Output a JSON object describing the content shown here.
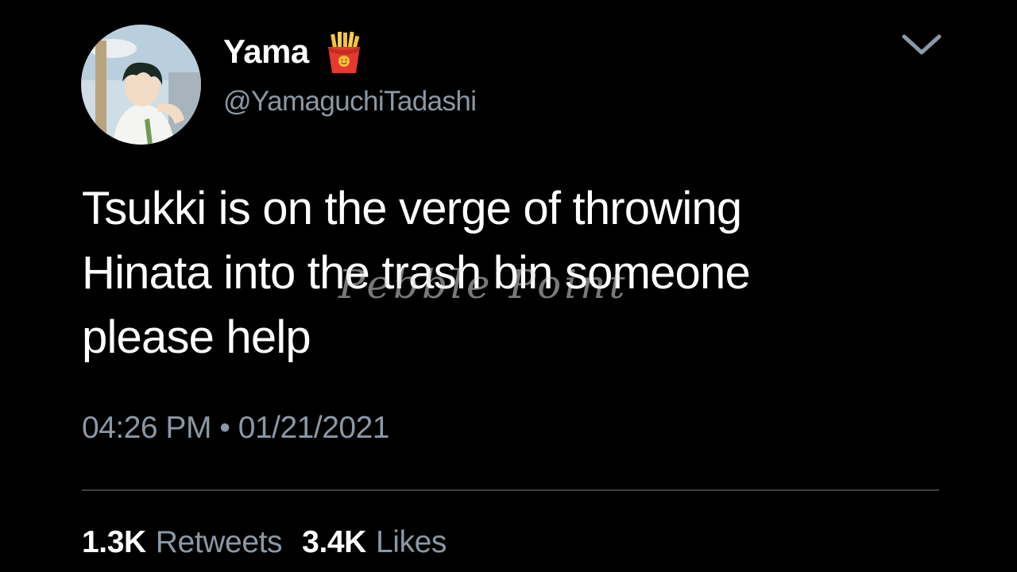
{
  "user": {
    "display_name": "Yama",
    "handle": "@YamaguchiTadashi",
    "badge_icon": "fries-emoji-icon"
  },
  "tweet": {
    "lines": [
      "Tsukki is on the verge of throwing",
      "Hinata into the trash bin someone",
      "please help"
    ],
    "time": "04:26 PM",
    "separator": "•",
    "date": "01/21/2021"
  },
  "watermark": "Pebble Point",
  "stats": {
    "retweets_count": "1.3K",
    "retweets_label": "Retweets",
    "likes_count": "3.4K",
    "likes_label": "Likes"
  },
  "colors": {
    "background": "#000000",
    "primary_text": "#ffffff",
    "secondary_text": "#8b98a5",
    "divider": "#3a3f44"
  }
}
